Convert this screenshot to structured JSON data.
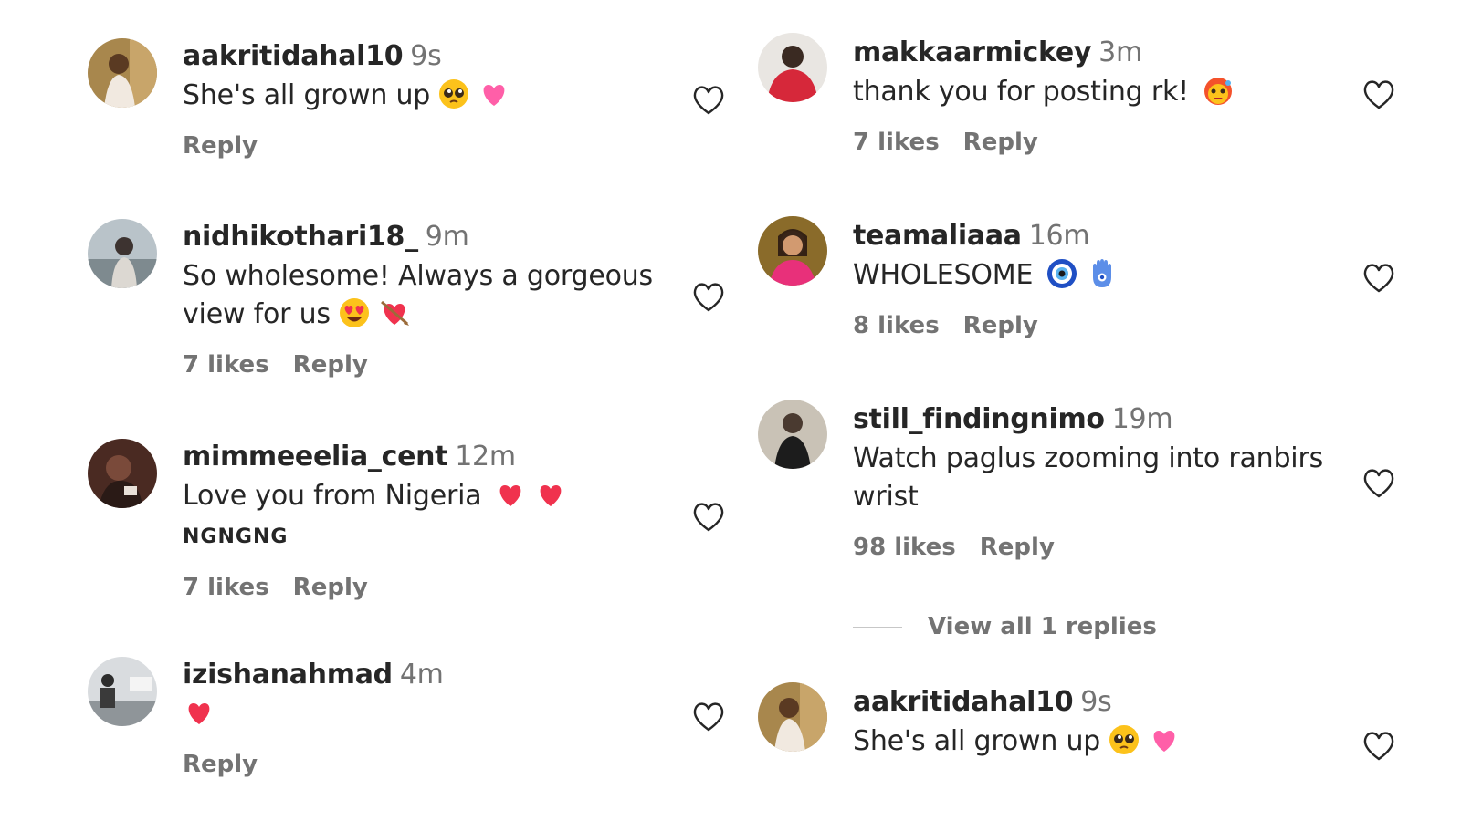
{
  "left_column": [
    {
      "username": "aakritidahal10",
      "time": "9s",
      "text": "She's all grown up",
      "emojis": [
        "pleading-face",
        "pink-heart"
      ],
      "tag": "",
      "likes": "",
      "reply": "Reply"
    },
    {
      "username": "nidhikothari18_",
      "time": "9m",
      "text": "So wholesome! Always a gorgeous view for us",
      "emojis": [
        "heart-eyes",
        "heart-with-arrow"
      ],
      "tag": "",
      "likes": "7 likes",
      "reply": "Reply"
    },
    {
      "username": "mimmeeelia_cent",
      "time": "12m",
      "text": "Love you from Nigeria",
      "emojis": [
        "red-heart",
        "red-heart"
      ],
      "tag": "NGNGNG",
      "likes": "7 likes",
      "reply": "Reply"
    },
    {
      "username": "izishanahmad",
      "time": "4m",
      "text": "",
      "emojis": [
        "red-heart"
      ],
      "tag": "",
      "likes": "",
      "reply": "Reply"
    }
  ],
  "right_column": [
    {
      "username": "makkaarmickey",
      "time": "3m",
      "text": "thank you for posting rk!",
      "emojis": [
        "hot-face"
      ],
      "tag": "",
      "likes": "7 likes",
      "reply": "Reply"
    },
    {
      "username": "teamaliaaa",
      "time": "16m",
      "text": "WHOLESOME",
      "emojis": [
        "nazar-amulet",
        "hamsa"
      ],
      "tag": "",
      "likes": "8 likes",
      "reply": "Reply"
    },
    {
      "username": "still_findingnimo",
      "time": "19m",
      "text": "Watch paglus zooming into ranbirs wrist",
      "emojis": [],
      "tag": "",
      "likes": "98 likes",
      "reply": "Reply"
    },
    {
      "username": "aakritidahal10",
      "time": "9s",
      "text": "She's all grown up",
      "emojis": [
        "pleading-face",
        "pink-heart"
      ],
      "tag": "",
      "likes": "",
      "reply": ""
    }
  ],
  "view_replies_label": "View all 1 replies",
  "colors": {
    "text": "#262626",
    "secondary": "#737373",
    "red_heart": "#f0324e",
    "pink_heart": "#ff5fa8"
  }
}
